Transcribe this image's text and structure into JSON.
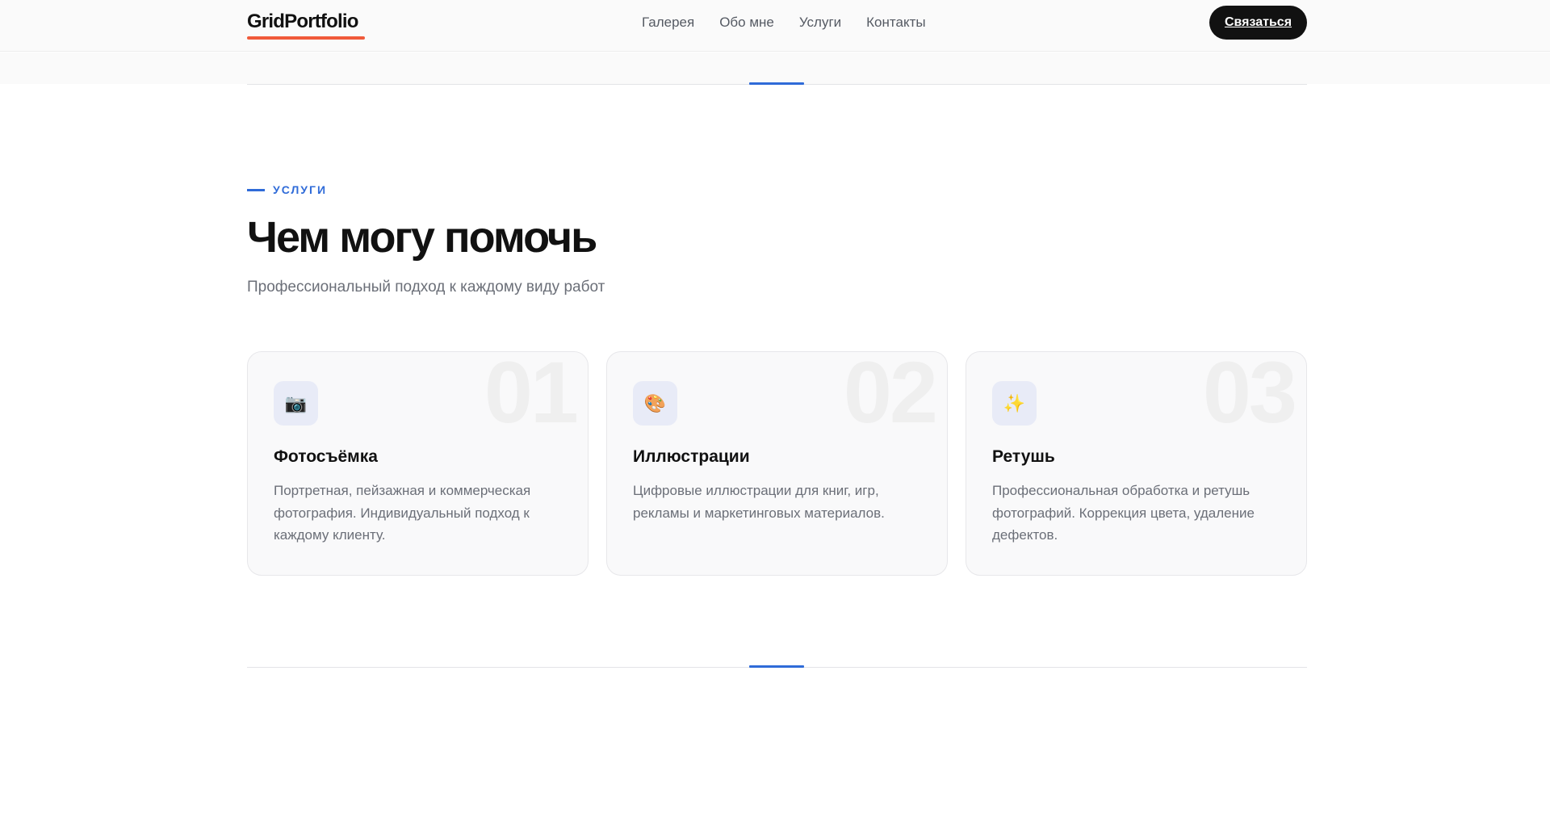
{
  "header": {
    "logo": "GridPortfolio",
    "nav": [
      "Галерея",
      "Обо мне",
      "Услуги",
      "Контакты"
    ],
    "cta_label": "Связаться"
  },
  "colors": {
    "accent": "#2f6bd8",
    "logo_underline": "#f05a3a",
    "dark": "#111111"
  },
  "services": {
    "eyebrow": "УСЛУГИ",
    "title": "Чем могу помочь",
    "subtitle": "Профессиональный подход к каждому виду работ",
    "cards": [
      {
        "number": "01",
        "icon": "camera-icon",
        "glyph": "📷",
        "title": "Фотосъёмка",
        "text": "Портретная, пейзажная и коммерческая фотография. Индивидуальный подход к каждому клиенту."
      },
      {
        "number": "02",
        "icon": "palette-icon",
        "glyph": "🎨",
        "title": "Иллюстрации",
        "text": "Цифровые иллюстрации для книг, игр, рекламы и маркетинговых материалов."
      },
      {
        "number": "03",
        "icon": "sparkles-icon",
        "glyph": "✨",
        "title": "Ретушь",
        "text": "Профессиональная обработка и ретушь фотографий. Коррекция цвета, удаление дефектов."
      }
    ]
  }
}
